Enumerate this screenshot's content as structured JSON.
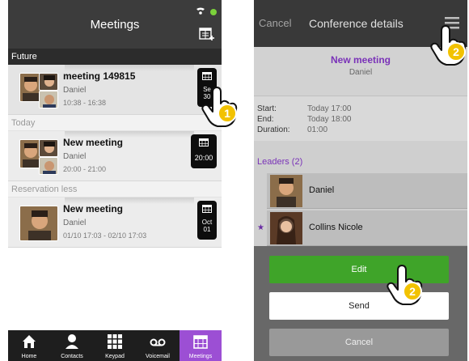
{
  "left": {
    "title": "Meetings",
    "sections": {
      "future": "Future",
      "today": "Today",
      "reservation": "Reservation less"
    },
    "meetings": [
      {
        "title": "meeting 149815",
        "organizer": "Daniel",
        "time": "10:38 - 16:38",
        "badge_top": "Se",
        "badge_bottom": "30"
      },
      {
        "title": "New meeting",
        "organizer": "Daniel",
        "time": "20:00 - 21:00",
        "badge": "20:00"
      },
      {
        "title": "New meeting",
        "organizer": "Daniel",
        "time": "01/10 17:03 - 02/10 17:03",
        "badge_top": "Oct",
        "badge_bottom": "01"
      }
    ],
    "tabs": [
      {
        "label": "Home",
        "icon": "home-icon"
      },
      {
        "label": "Contacts",
        "icon": "contacts-icon"
      },
      {
        "label": "Keypad",
        "icon": "keypad-icon"
      },
      {
        "label": "Voicemail",
        "icon": "voicemail-icon"
      },
      {
        "label": "Meetings",
        "icon": "meetings-icon",
        "active": true
      }
    ],
    "step_marker": "1"
  },
  "right": {
    "cancel": "Cancel",
    "title": "Conference details",
    "meeting_title": "New meeting",
    "meeting_owner": "Daniel",
    "start_label": "Start:",
    "start_value": "Today 17:00",
    "end_label": "End:",
    "end_value": "Today 18:00",
    "duration_label": "Duration:",
    "duration_value": "01:00",
    "leaders_header": "Leaders (2)",
    "leaders": [
      "Daniel",
      "Collins Nicole"
    ],
    "buttons": {
      "edit": "Edit",
      "send": "Send",
      "cancel": "Cancel"
    },
    "step_marker_menu": "2",
    "step_marker_edit": "2"
  },
  "colors": {
    "accent_purple": "#9c4fd4",
    "edit_green": "#3fa429",
    "header_dark": "#3c3c3c",
    "status_green": "#7bd13b"
  }
}
